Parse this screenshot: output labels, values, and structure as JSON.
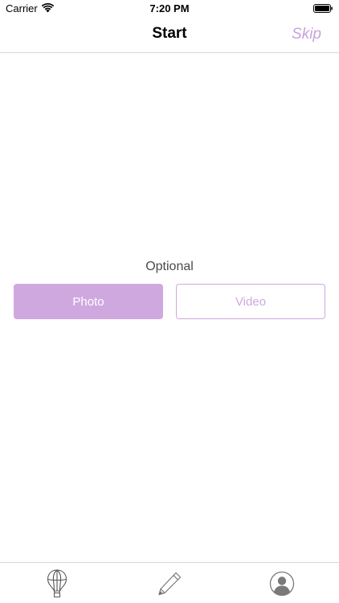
{
  "status_bar": {
    "carrier": "Carrier",
    "time": "7:20 PM",
    "icons": [
      "wifi-icon",
      "battery-icon"
    ]
  },
  "nav": {
    "title": "Start",
    "skip_label": "Skip"
  },
  "content": {
    "optional_label": "Optional",
    "photo_label": "Photo",
    "video_label": "Video"
  },
  "tab_bar": {
    "tabs": [
      {
        "icon": "hot-air-balloon-icon"
      },
      {
        "icon": "pencil-icon"
      },
      {
        "icon": "profile-icon"
      }
    ]
  },
  "colors": {
    "accent": "#d0a8e0",
    "accent_text": "#c9a2dc",
    "icon_gray": "#7a7a7a"
  }
}
